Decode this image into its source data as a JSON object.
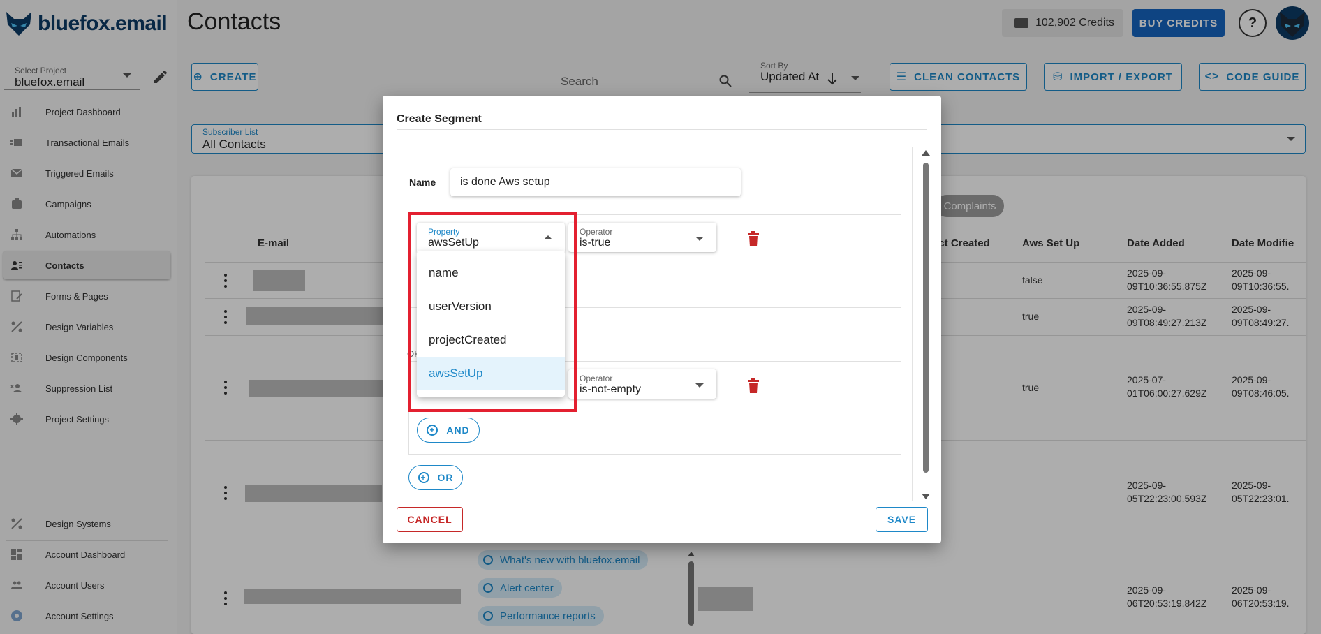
{
  "app": {
    "brand": "bluefox.email",
    "page_title": "Contacts",
    "credits": "102,902 Credits",
    "buy_credits": "BUY CREDITS",
    "help": "?"
  },
  "sidebar": {
    "project_label": "Select Project",
    "project_value": "bluefox.email",
    "items": [
      {
        "label": "Project Dashboard",
        "icon": "chart-icon"
      },
      {
        "label": "Transactional Emails",
        "icon": "mail-list-icon"
      },
      {
        "label": "Triggered Emails",
        "icon": "mail-icon"
      },
      {
        "label": "Campaigns",
        "icon": "campaign-icon"
      },
      {
        "label": "Automations",
        "icon": "sitemap-icon"
      },
      {
        "label": "Contacts",
        "icon": "contacts-icon"
      },
      {
        "label": "Forms & Pages",
        "icon": "form-icon"
      },
      {
        "label": "Design Variables",
        "icon": "variables-icon"
      },
      {
        "label": "Design Components",
        "icon": "components-icon"
      },
      {
        "label": "Suppression List",
        "icon": "suppression-icon"
      },
      {
        "label": "Project Settings",
        "icon": "gear-icon"
      }
    ],
    "bottom_items": [
      {
        "label": "Design Systems",
        "icon": "design-icon"
      },
      {
        "label": "Account Dashboard",
        "icon": "dashboard-icon"
      },
      {
        "label": "Account Users",
        "icon": "users-icon"
      },
      {
        "label": "Account Settings",
        "icon": "account-gear-icon"
      }
    ]
  },
  "toolbar": {
    "create": "CREATE",
    "search_placeholder": "Search",
    "sort_label": "Sort By",
    "sort_value": "Updated At",
    "clean_contacts": "CLEAN CONTACTS",
    "import_export": "IMPORT / EXPORT",
    "code_guide": "CODE GUIDE"
  },
  "subscriber_list": {
    "label": "Subscriber List",
    "value": "All Contacts"
  },
  "table": {
    "complaints_chip": "Complaints",
    "headers": {
      "email": "E-mail",
      "project_created": "ect Created",
      "aws_set_up": "Aws Set Up",
      "date_added": "Date Added",
      "date_modified": "Date Modifie"
    },
    "rows": [
      {
        "aws": "false",
        "added": [
          "2025-09-",
          "09T10:36:55.875Z"
        ],
        "modified": [
          "2025-09-",
          "09T10:36:55."
        ]
      },
      {
        "aws": "true",
        "added": [
          "2025-09-",
          "09T08:49:27.213Z"
        ],
        "modified": [
          "2025-09-",
          "09T08:49:27."
        ]
      },
      {
        "aws": "true",
        "added": [
          "2025-07-",
          "01T06:00:27.629Z"
        ],
        "modified": [
          "2025-09-",
          "09T08:46:05."
        ]
      },
      {
        "aws": "",
        "added": [
          "2025-09-",
          "05T22:23:00.593Z"
        ],
        "modified": [
          "2025-09-",
          "05T22:23:01."
        ]
      },
      {
        "aws": "",
        "added": [
          "2025-09-",
          "06T20:53:19.842Z"
        ],
        "modified": [
          "2025-09-",
          "06T20:53:19."
        ]
      }
    ],
    "chips": [
      "What's new with bluefox.email",
      "Alert center",
      "Performance reports"
    ]
  },
  "dialog": {
    "title": "Create Segment",
    "name_label": "Name",
    "name_value": "is done Aws setup",
    "condition1": {
      "property_label": "Property",
      "property_value": "awsSetUp",
      "operator_label": "Operator",
      "operator_value": "is-true"
    },
    "or_partial": "OF",
    "condition2": {
      "operator_label": "Operator",
      "operator_value": "is-not-empty"
    },
    "and_button": "AND",
    "or_button": "OR",
    "cancel": "CANCEL",
    "save": "SAVE",
    "dropdown_options": [
      "name",
      "userVersion",
      "projectCreated",
      "awsSetUp"
    ],
    "dropdown_selected": "awsSetUp"
  },
  "colors": {
    "accent": "#1e88c8",
    "brand_dark": "#0d3b66",
    "danger": "#c62828",
    "highlight": "#e32030"
  }
}
